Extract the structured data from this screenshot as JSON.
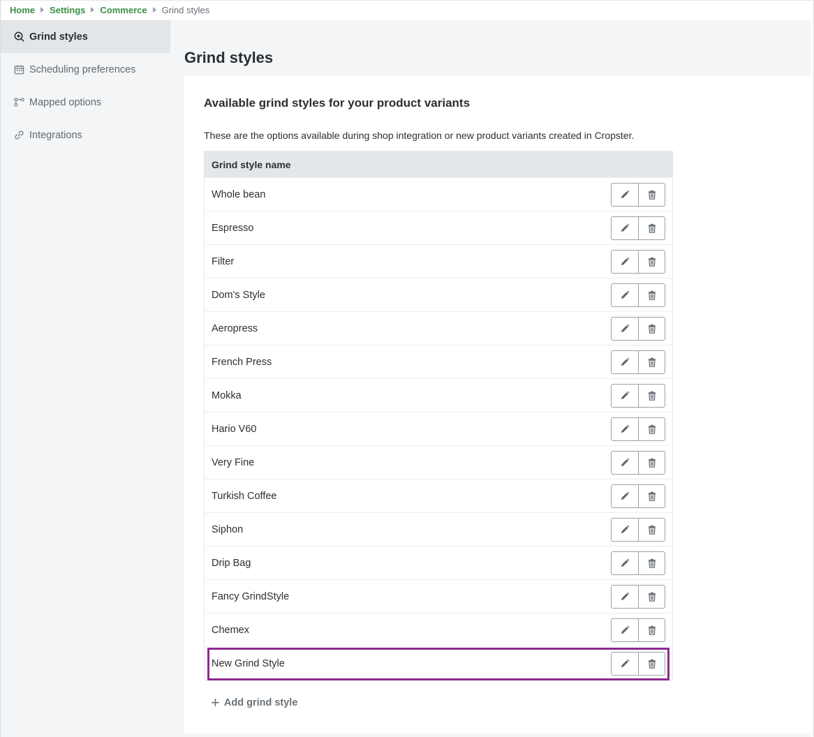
{
  "breadcrumb": {
    "items": [
      {
        "label": "Home"
      },
      {
        "label": "Settings"
      },
      {
        "label": "Commerce"
      }
    ],
    "current": "Grind styles"
  },
  "sidebar": {
    "items": [
      {
        "label": "Grind styles",
        "icon": "grind-icon",
        "active": true
      },
      {
        "label": "Scheduling preferences",
        "icon": "calendar-icon",
        "active": false
      },
      {
        "label": "Mapped options",
        "icon": "mapping-icon",
        "active": false
      },
      {
        "label": "Integrations",
        "icon": "link-icon",
        "active": false
      }
    ]
  },
  "page": {
    "title": "Grind styles"
  },
  "card": {
    "title": "Available grind styles for your product variants",
    "description": "These are the options available during shop integration or new product variants created in Cropster."
  },
  "table": {
    "header": "Grind style name",
    "rows": [
      "Whole bean",
      "Espresso",
      "Filter",
      "Dom's Style",
      "Aeropress",
      "French Press",
      "Mokka",
      "Hario V60",
      "Very Fine",
      "Turkish Coffee",
      "Siphon",
      "Drip Bag",
      "Fancy GrindStyle",
      "Chemex",
      "New Grind Style"
    ],
    "highlighted_row": "New Grind Style"
  },
  "add_button": {
    "label": "Add grind style"
  },
  "colors": {
    "brand_green": "#3a8f45",
    "highlight": "#8e2a8e"
  }
}
